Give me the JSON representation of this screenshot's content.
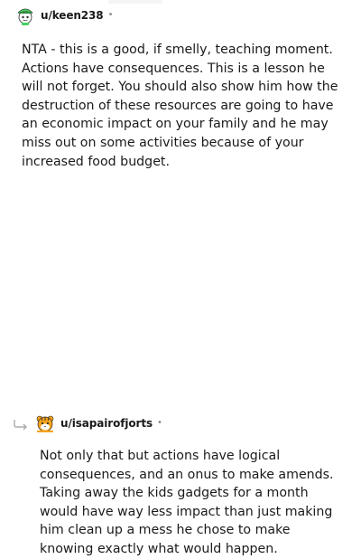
{
  "comments": [
    {
      "username": "u/keen238",
      "separator": "•",
      "avatar": "reddit-snoo-avatar-green-hat",
      "text": "NTA - this is a good, if smelly, teaching moment. Actions have consequences. This is a lesson he will not forget. You should also show him how the destruction of these resources are going to have an economic impact on your family and he may miss out on some activities because of your increased food budget."
    },
    {
      "username": "u/isapairofjorts",
      "separator": "•",
      "avatar": "reddit-snoo-avatar-tiger",
      "reply_icon": "reply-arrow-icon",
      "text": "Not only that but actions have logical consequences, and an onus to make amends. Taking away the kids gadgets for a month would have way less impact than just making him clean up a mess he chose to make knowing exactly what would happen."
    }
  ],
  "colors": {
    "text": "#1a1a1b",
    "meta": "#878a8c",
    "avatar_green": "#46d160",
    "tiger_orange": "#f7a31c"
  }
}
